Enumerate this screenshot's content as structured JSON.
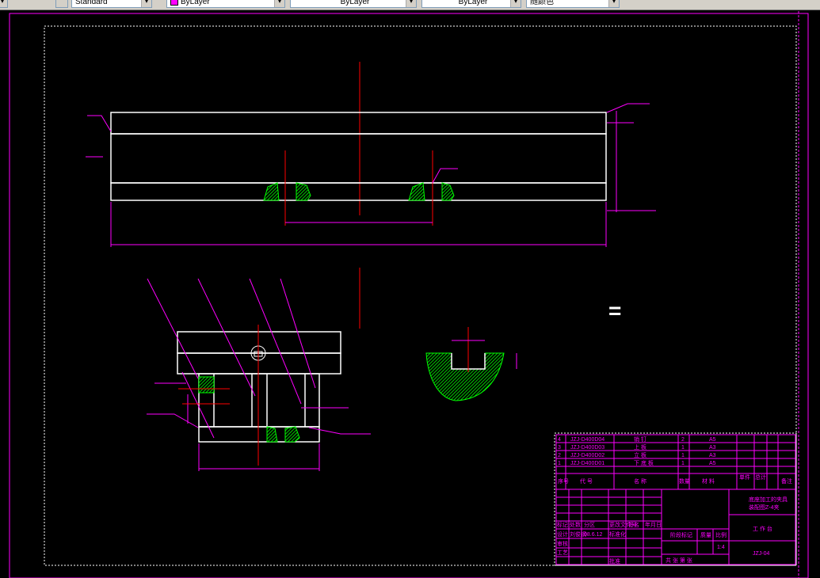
{
  "toolbar": {
    "textstyle": "Standard",
    "layer": "ByLayer",
    "linetype": "ByLayer",
    "lineweight": "ByLayer",
    "plotstyle": "随颜色"
  },
  "colors": {
    "frame": "#ff00ff",
    "outline": "#ffffff",
    "center": "#ff0000",
    "hatch": "#00ff00",
    "dim": "#ff00ff"
  },
  "bom": {
    "rows": [
      {
        "no": "4",
        "code": "JZJ-D400D04",
        "name": "销  钉",
        "qty": "2",
        "material": "A5"
      },
      {
        "no": "3",
        "code": "JZJ-D400D03",
        "name": "上  板",
        "qty": "1",
        "material": "A3"
      },
      {
        "no": "2",
        "code": "JZJ-D400D02",
        "name": "立  板",
        "qty": "1",
        "material": "A3"
      },
      {
        "no": "1",
        "code": "JZJ-D400D01",
        "name": "下 底 板",
        "qty": "1",
        "material": "A5"
      }
    ],
    "header": {
      "no": "序号",
      "code": "代  号",
      "name": "名  称",
      "qty": "数量",
      "material": "材  料",
      "unit_mass": "单件",
      "total_mass": "总计",
      "remark": "备注"
    }
  },
  "title_block": {
    "title_line1": "底座加工的夹具",
    "title_line2": "装配图Z-4夹",
    "unit": "工 作 台",
    "drawing_no": "JZJ-04",
    "scale": "1:4",
    "stage_mark": "阶段标记",
    "mass": "质量",
    "scale_label": "比例",
    "sheets": "共  张  第  张",
    "rows": [
      "标记",
      "处数",
      "分区",
      "更改文件号",
      "签名",
      "年月日"
    ],
    "design": "设计",
    "designer": "刘俊钢",
    "date": "08.6.12",
    "standard": "标准化",
    "check": "审核",
    "process": "工艺",
    "approve": "批准"
  },
  "section_mark": "="
}
